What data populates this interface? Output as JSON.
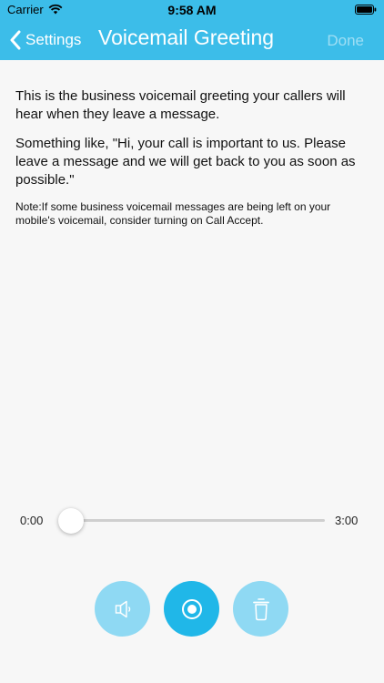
{
  "status_bar": {
    "carrier": "Carrier",
    "time": "9:58 AM",
    "wifi_icon": "wifi-icon",
    "battery_icon": "battery-icon"
  },
  "nav": {
    "back_label": "Settings",
    "back_icon": "chevron-left-icon",
    "title": "Voicemail Greeting",
    "done_label": "Done"
  },
  "content": {
    "intro": "This is the business voicemail greeting your callers will hear when they leave a message.",
    "example": "Something like, \"Hi, your call is important to us. Please leave a message and we will get back to you as soon as possible.\"",
    "note": "Note:If some business voicemail messages are being left on your mobile's voicemail, consider turning on Call Accept."
  },
  "player": {
    "current_time": "0:00",
    "total_time": "3:00",
    "progress": 0
  },
  "controls": {
    "speaker_icon": "speaker-icon",
    "record_icon": "record-icon",
    "delete_icon": "trash-icon"
  },
  "colors": {
    "header": "#3cbde9",
    "accent": "#20b7e8",
    "accent_light": "#8fd9f3",
    "background": "#f7f7f7"
  }
}
